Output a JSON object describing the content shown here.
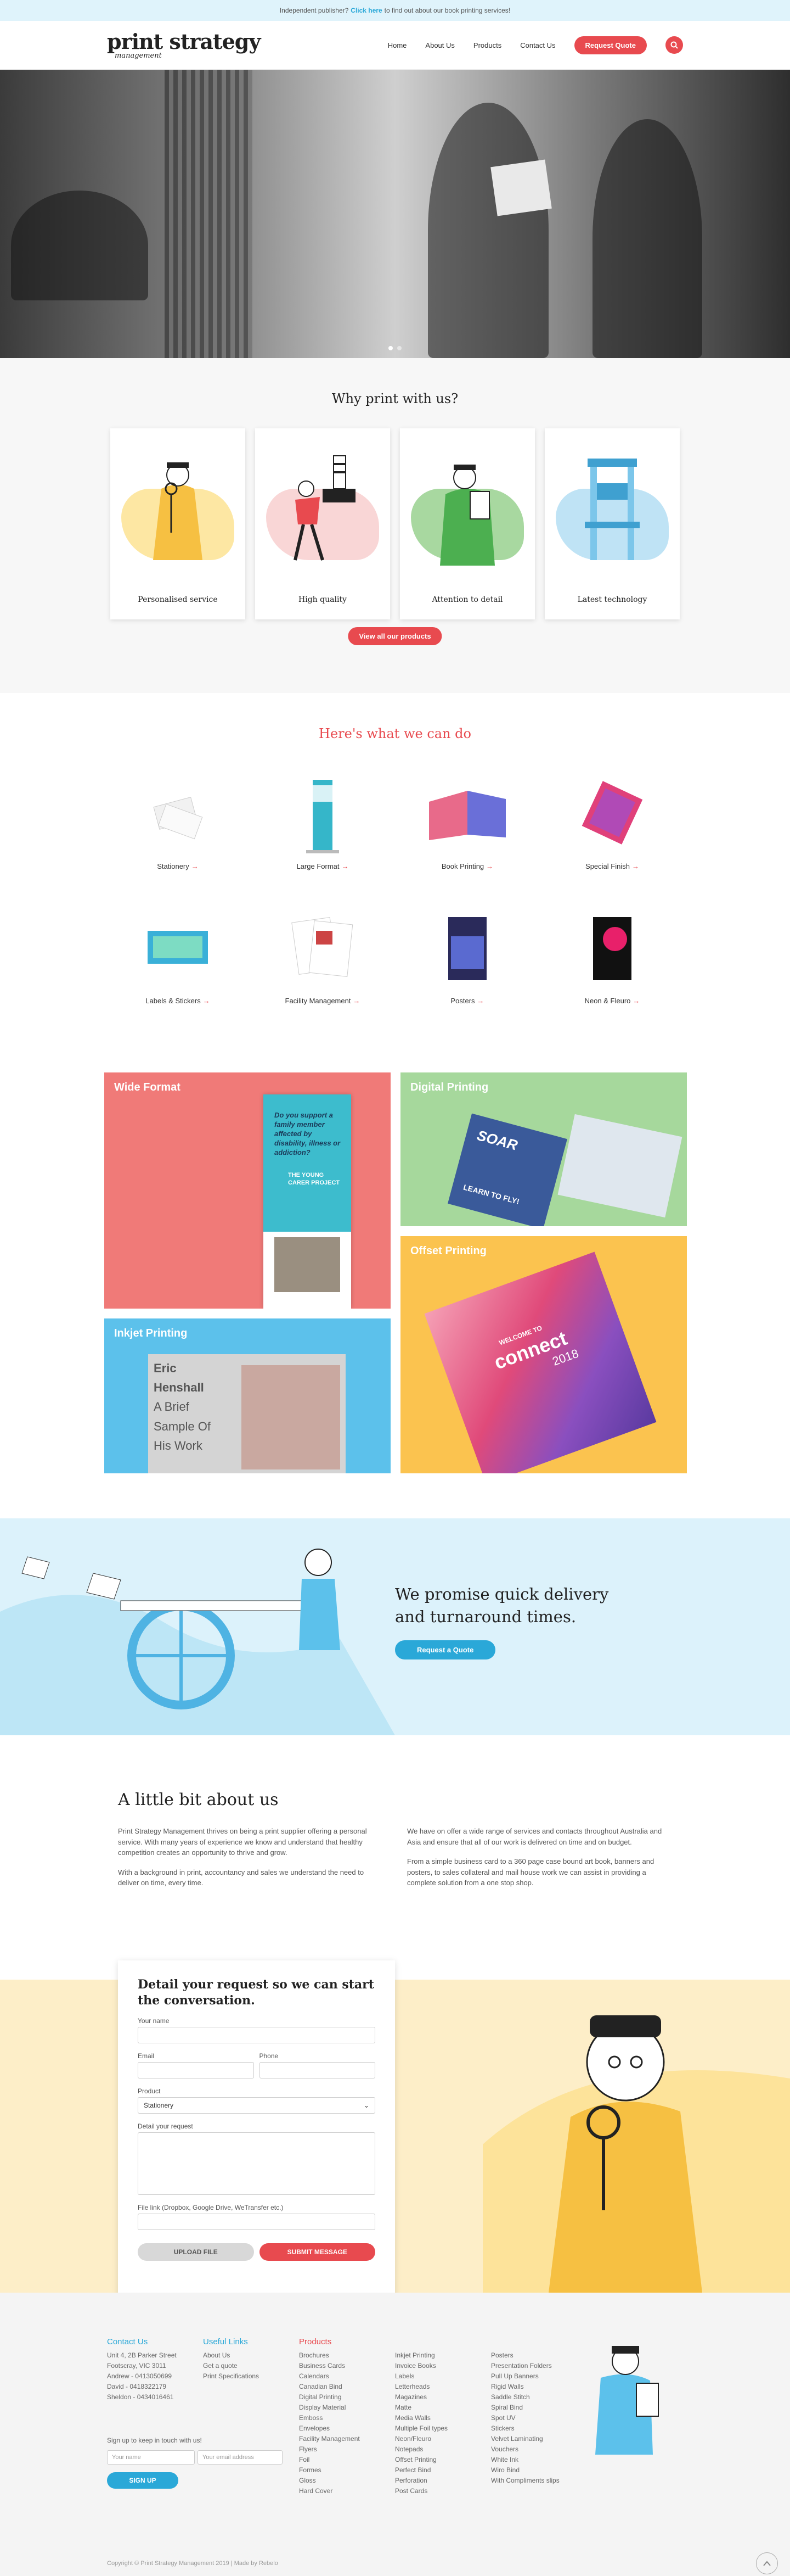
{
  "topbar": {
    "pre": "Independent publisher?",
    "link": "Click here",
    "post": "to find out about our book printing services!"
  },
  "logo": {
    "line1": "print strategy",
    "line2": "management"
  },
  "nav": {
    "items": [
      "Home",
      "About Us",
      "Products",
      "Contact Us"
    ],
    "cta": "Request Quote"
  },
  "why": {
    "title": "Why print with us?",
    "cards": [
      "Personalised service",
      "High quality",
      "Attention to detail",
      "Latest technology"
    ],
    "button": "View all our products"
  },
  "services": {
    "title": "Here's what we can do",
    "items": [
      "Stationery",
      "Large Format",
      "Book Printing",
      "Special Finish",
      "Labels & Stickers",
      "Facility Management",
      "Posters",
      "Neon & Fleuro"
    ]
  },
  "tiles": {
    "wide": "Wide Format",
    "digital": "Digital Printing",
    "offset": "Offset Printing",
    "inkjet": "Inkjet Printing",
    "banner_text": "Do you support a family member affected by disability, illness or addiction?",
    "banner_brand": "THE YOUNG CARER PROJECT",
    "inkjet_text": [
      "Eric",
      "Henshall",
      "A Brief",
      "Sample Of",
      "His Work"
    ],
    "soar": "SOAR",
    "learn": "LEARN TO FLY!",
    "connect": "connect",
    "welcome": "WELCOME TO",
    "year": "2018"
  },
  "promise": {
    "line1": "We promise quick delivery",
    "line2": "and turnaround times.",
    "button": "Request a Quote"
  },
  "about": {
    "title": "A little bit about us",
    "p1": "Print Strategy Management thrives on being a print supplier offering a personal service. With many years of experience we know and understand that healthy competition creates an opportunity to thrive and grow.",
    "p2": "With a background in print, accountancy and sales we understand the need to deliver on time, every time.",
    "p3": "We have on offer a wide range of services and contacts throughout Australia and Asia and ensure that all of our work is delivered on time and on budget.",
    "p4": "From a simple business card to a 360 page case bound art book, banners and posters, to sales collateral and mail house work we can assist in providing a complete solution from a one stop shop."
  },
  "form": {
    "title": "Detail your request so we can start the conversation.",
    "name": "Your name",
    "email": "Email",
    "phone": "Phone",
    "product": "Product",
    "product_value": "Stationery",
    "detail": "Detail your request",
    "filelink": "File link (Dropbox, Google Drive, WeTransfer etc.)",
    "upload": "UPLOAD FILE",
    "submit": "SUBMIT MESSAGE"
  },
  "footer": {
    "contact_title": "Contact Us",
    "contact": [
      "Unit 4, 2B Parker Street",
      "Footscray, VIC 3011",
      "Andrew - 0413050699",
      "David - 0418322179",
      "Sheldon - 0434016461"
    ],
    "useful_title": "Useful Links",
    "useful": [
      "About Us",
      "Get a quote",
      "Print Specifications"
    ],
    "products_title": "Products",
    "products_col1": [
      "Brochures",
      "Business Cards",
      "Calendars",
      "Canadian Bind",
      "Digital Printing",
      "Display Material",
      "Emboss",
      "Envelopes",
      "Facility Management",
      "Flyers",
      "Foil",
      "Formes",
      "Gloss",
      "Hard Cover"
    ],
    "products_col2": [
      "Inkjet Printing",
      "Invoice Books",
      "Labels",
      "Letterheads",
      "Magazines",
      "Matte",
      "Media Walls",
      "Multiple Foil types",
      "Neon/Fleuro",
      "Notepads",
      "Offset Printing",
      "Perfect Bind",
      "Perforation",
      "Post Cards"
    ],
    "products_col3": [
      "Posters",
      "Presentation Folders",
      "Pull Up Banners",
      "Rigid Walls",
      "Saddle Stitch",
      "Spiral Bind",
      "Spot UV",
      "Stickers",
      "Velvet Laminating",
      "Vouchers",
      "White Ink",
      "Wiro Bind",
      "With Compliments slips"
    ],
    "newsletter": "Sign up to keep in touch with us!",
    "name_ph": "Your name",
    "email_ph": "Your email address",
    "signup": "SIGN UP",
    "copyright": "Copyright © Print Strategy Management 2019  |  Made by Rebelo"
  }
}
